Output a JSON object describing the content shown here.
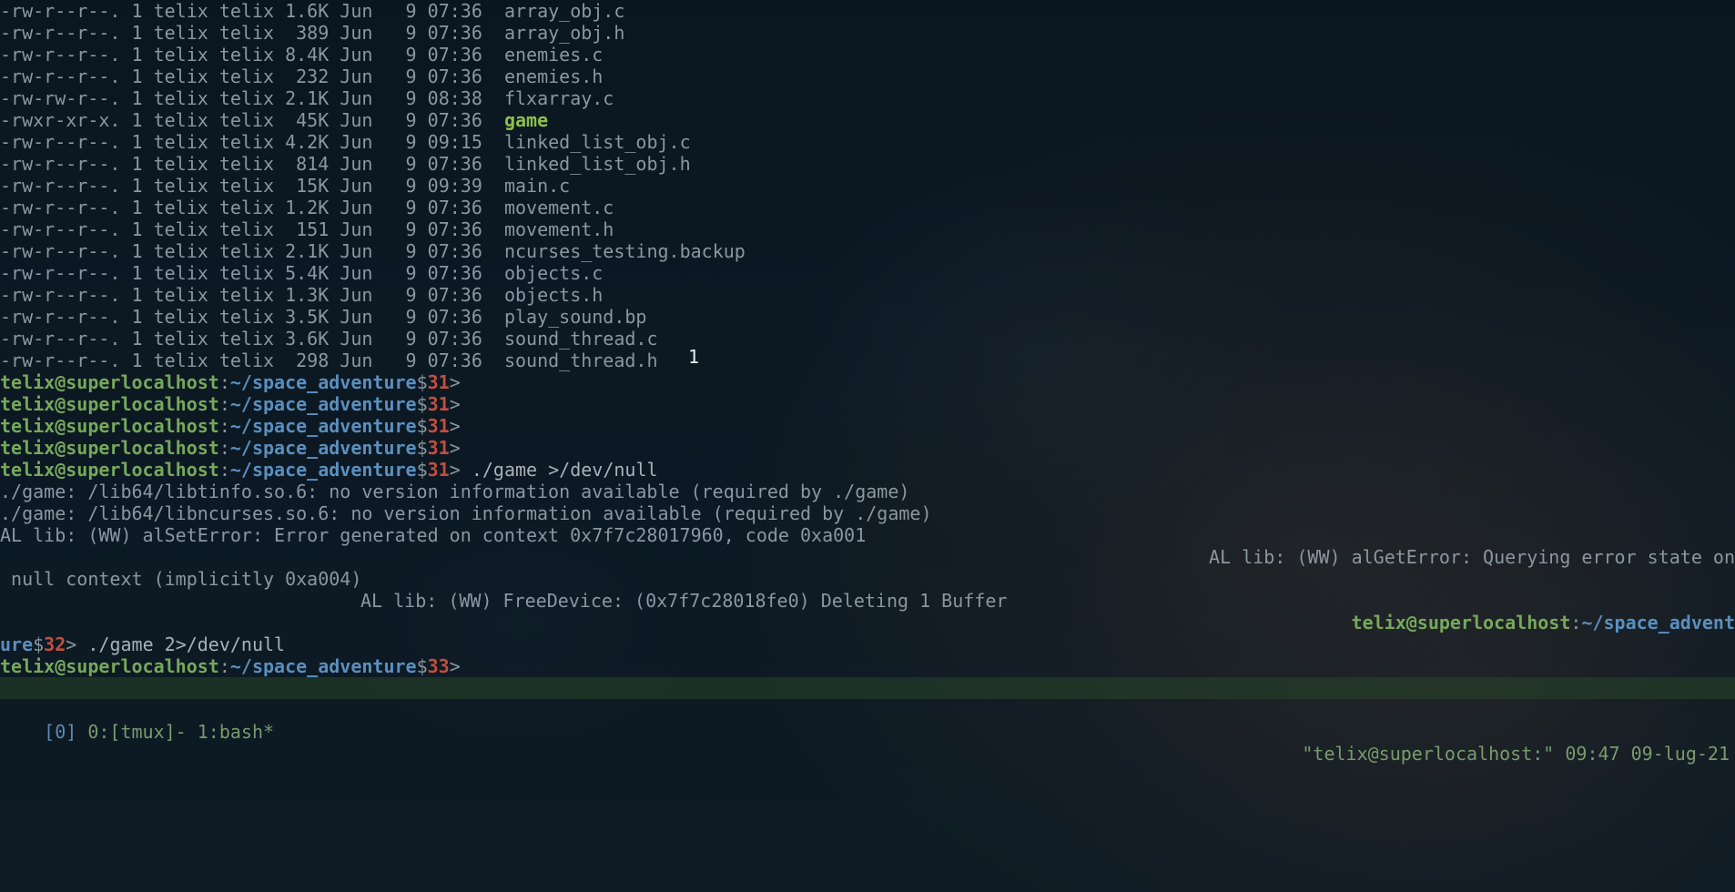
{
  "ls": [
    {
      "perms": "-rw-r--r--.",
      "links": "1",
      "owner": "telix",
      "group": "telix",
      "size": "1.6K",
      "month": "Jun",
      "day": "9",
      "time": "07:36",
      "name": "array_obj.c",
      "exec": false
    },
    {
      "perms": "-rw-r--r--.",
      "links": "1",
      "owner": "telix",
      "group": "telix",
      "size": "389",
      "month": "Jun",
      "day": "9",
      "time": "07:36",
      "name": "array_obj.h",
      "exec": false
    },
    {
      "perms": "-rw-r--r--.",
      "links": "1",
      "owner": "telix",
      "group": "telix",
      "size": "8.4K",
      "month": "Jun",
      "day": "9",
      "time": "07:36",
      "name": "enemies.c",
      "exec": false
    },
    {
      "perms": "-rw-r--r--.",
      "links": "1",
      "owner": "telix",
      "group": "telix",
      "size": "232",
      "month": "Jun",
      "day": "9",
      "time": "07:36",
      "name": "enemies.h",
      "exec": false
    },
    {
      "perms": "-rw-rw-r--.",
      "links": "1",
      "owner": "telix",
      "group": "telix",
      "size": "2.1K",
      "month": "Jun",
      "day": "9",
      "time": "08:38",
      "name": "flxarray.c",
      "exec": false
    },
    {
      "perms": "-rwxr-xr-x.",
      "links": "1",
      "owner": "telix",
      "group": "telix",
      "size": "45K",
      "month": "Jun",
      "day": "9",
      "time": "07:36",
      "name": "game",
      "exec": true
    },
    {
      "perms": "-rw-r--r--.",
      "links": "1",
      "owner": "telix",
      "group": "telix",
      "size": "4.2K",
      "month": "Jun",
      "day": "9",
      "time": "09:15",
      "name": "linked_list_obj.c",
      "exec": false
    },
    {
      "perms": "-rw-r--r--.",
      "links": "1",
      "owner": "telix",
      "group": "telix",
      "size": "814",
      "month": "Jun",
      "day": "9",
      "time": "07:36",
      "name": "linked_list_obj.h",
      "exec": false
    },
    {
      "perms": "-rw-r--r--.",
      "links": "1",
      "owner": "telix",
      "group": "telix",
      "size": "15K",
      "month": "Jun",
      "day": "9",
      "time": "09:39",
      "name": "main.c",
      "exec": false
    },
    {
      "perms": "-rw-r--r--.",
      "links": "1",
      "owner": "telix",
      "group": "telix",
      "size": "1.2K",
      "month": "Jun",
      "day": "9",
      "time": "07:36",
      "name": "movement.c",
      "exec": false
    },
    {
      "perms": "-rw-r--r--.",
      "links": "1",
      "owner": "telix",
      "group": "telix",
      "size": "151",
      "month": "Jun",
      "day": "9",
      "time": "07:36",
      "name": "movement.h",
      "exec": false
    },
    {
      "perms": "-rw-r--r--.",
      "links": "1",
      "owner": "telix",
      "group": "telix",
      "size": "2.1K",
      "month": "Jun",
      "day": "9",
      "time": "07:36",
      "name": "ncurses_testing.backup",
      "exec": false
    },
    {
      "perms": "-rw-r--r--.",
      "links": "1",
      "owner": "telix",
      "group": "telix",
      "size": "5.4K",
      "month": "Jun",
      "day": "9",
      "time": "07:36",
      "name": "objects.c",
      "exec": false
    },
    {
      "perms": "-rw-r--r--.",
      "links": "1",
      "owner": "telix",
      "group": "telix",
      "size": "1.3K",
      "month": "Jun",
      "day": "9",
      "time": "07:36",
      "name": "objects.h",
      "exec": false
    },
    {
      "perms": "-rw-r--r--.",
      "links": "1",
      "owner": "telix",
      "group": "telix",
      "size": "3.5K",
      "month": "Jun",
      "day": "9",
      "time": "07:36",
      "name": "play_sound.bp",
      "exec": false
    },
    {
      "perms": "-rw-r--r--.",
      "links": "1",
      "owner": "telix",
      "group": "telix",
      "size": "3.6K",
      "month": "Jun",
      "day": "9",
      "time": "07:36",
      "name": "sound_thread.c",
      "exec": false
    },
    {
      "perms": "-rw-r--r--.",
      "links": "1",
      "owner": "telix",
      "group": "telix",
      "size": "298",
      "month": "Jun",
      "day": "9",
      "time": "07:36",
      "name": "sound_thread.h",
      "exec": false
    }
  ],
  "prompt": {
    "user": "telix",
    "at": "@",
    "host": "superlocalhost",
    "colon": ":",
    "path": "~/space_adventure",
    "dollar": "$",
    "gt": ">"
  },
  "empty_prompts": [
    "31",
    "31",
    "31",
    "31"
  ],
  "cmd1": {
    "num": "31",
    "text": "./game >/dev/null"
  },
  "output1": [
    "./game: /lib64/libtinfo.so.6: no version information available (required by ./game)",
    "./game: /lib64/libncurses.so.6: no version information available (required by ./game)",
    "AL lib: (WW) alSetError: Error generated on context 0x7f7c28017960, code 0xa001"
  ],
  "output1_wrap_right": "AL lib: (WW) alGetError: Querying error state on",
  "output1_wrap_left": " null context (implicitly 0xa004)",
  "output1_center": "AL lib: (WW) FreeDevice: (0x7f7c28018fe0) Deleting 1 Buffer",
  "wrap_prompt_right": "telix@superlocalhost:~/space_advent",
  "cmd2": {
    "prefix": "ure$",
    "num": "32",
    "text": "./game 2>/dev/null"
  },
  "cmd3": {
    "num": "33",
    "text": ""
  },
  "cursor_one": "1",
  "statusbar": {
    "left_idx": "[0]",
    "win0": " 0:[tmux]- ",
    "win1": "1:bash*",
    "right": "\"telix@superlocalhost:\" 09:47 09-lug-21"
  }
}
